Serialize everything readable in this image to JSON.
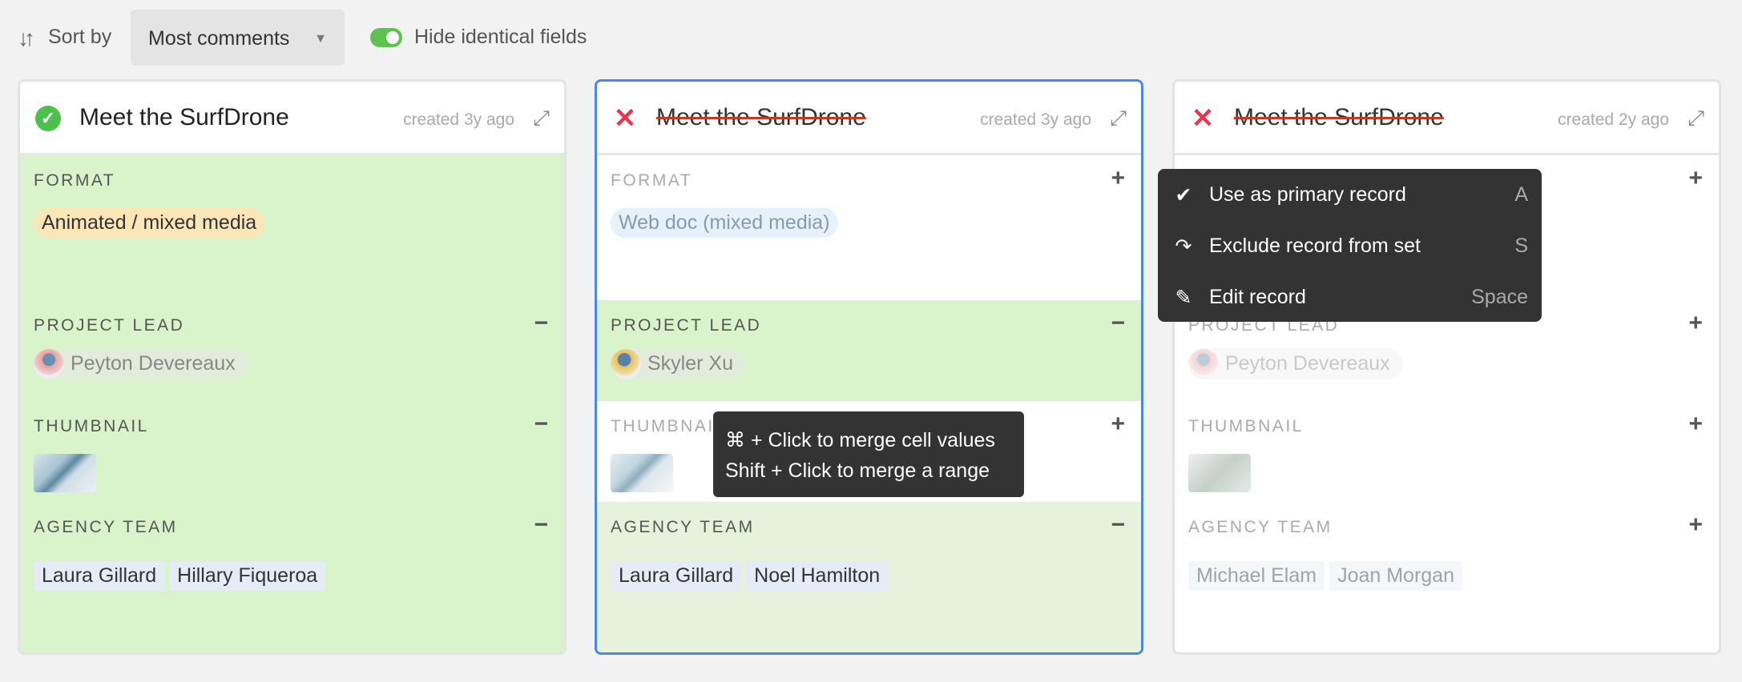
{
  "toolbar": {
    "sort_icon": "sort-arrows-icon",
    "sort_label": "Sort by",
    "sort_value": "Most comments",
    "toggle_on": true,
    "toggle_label": "Hide identical fields",
    "toggle_color": "#5ec24f"
  },
  "records": [
    {
      "title": "Meet the SurfDrone",
      "created": "created 3y ago",
      "status": "primary",
      "format": "Animated / mixed media",
      "project_lead": "Peyton Devereaux",
      "agency_team": [
        "Laura Gillard",
        "Hillary Fiqueroa"
      ]
    },
    {
      "title": "Meet the SurfDrone",
      "created": "created 3y ago",
      "status": "excluded",
      "format": "Web doc (mixed media)",
      "project_lead": "Skyler Xu",
      "agency_team": [
        "Laura Gillard",
        "Noel Hamilton"
      ]
    },
    {
      "title": "Meet the SurfDrone",
      "created": "created 2y ago",
      "status": "excluded",
      "format": "",
      "project_lead": "Peyton Devereaux",
      "agency_team": [
        "Michael Elam",
        "Joan Morgan"
      ]
    }
  ],
  "fields": {
    "format": "FORMAT",
    "project_lead": "PROJECT LEAD",
    "thumbnail": "THUMBNAIL",
    "agency_team": "AGENCY TEAM"
  },
  "tooltip": {
    "line1": "⌘ + Click to merge cell values",
    "line2": "Shift + Click to merge a range"
  },
  "context_menu": [
    {
      "icon": "check-icon",
      "label": "Use as primary record",
      "shortcut": "A"
    },
    {
      "icon": "redo-arrow-icon",
      "label": "Exclude record from set",
      "shortcut": "S"
    },
    {
      "icon": "pencil-icon",
      "label": "Edit record",
      "shortcut": "Space"
    }
  ],
  "colors": {
    "merged_green": "#d9f4cb",
    "selected_border": "#4a86f0",
    "excluded_x": "#e8374d"
  }
}
